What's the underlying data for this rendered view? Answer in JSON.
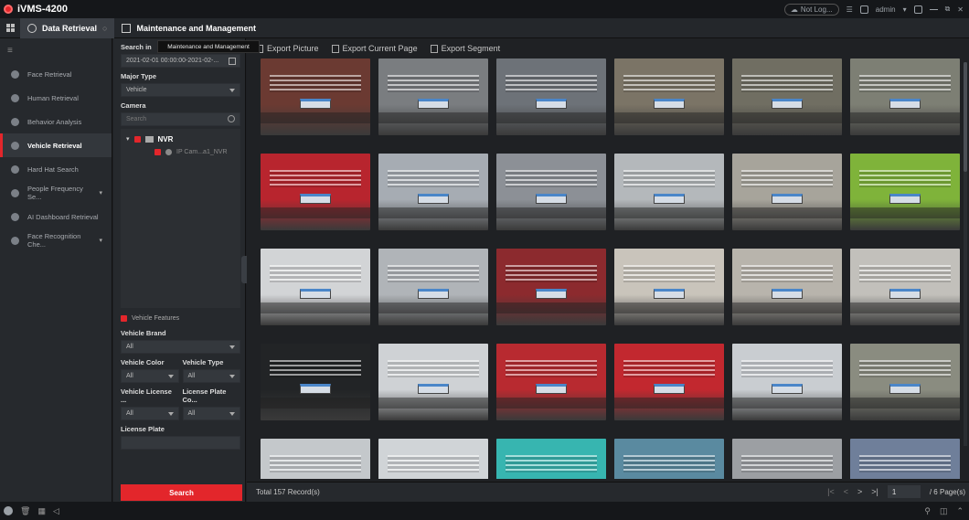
{
  "app": {
    "title": "iVMS-4200",
    "not_logged": "Not Log...",
    "user": "admin",
    "user_caret": "▾",
    "window_controls": [
      "☰",
      "▣",
      "—",
      "⧉",
      "✕"
    ]
  },
  "tabs": [
    {
      "label": "Data Retrieval",
      "close": "○"
    },
    {
      "label": "Maintenance and Management"
    }
  ],
  "tooltip": "Maintenance and Management",
  "nav": {
    "menu_icon": "≡",
    "items": [
      {
        "label": "Face Retrieval"
      },
      {
        "label": "Human Retrieval"
      },
      {
        "label": "Behavior Analysis"
      },
      {
        "label": "Vehicle Retrieval"
      },
      {
        "label": "Hard Hat Search"
      },
      {
        "label": "People Frequency Se...",
        "arrow": "▾"
      },
      {
        "label": "AI Dashboard Retrieval"
      },
      {
        "label": "Face Recognition Che...",
        "arrow": "▾"
      }
    ]
  },
  "filter": {
    "search_in_label": "Search in",
    "time_range": "2021-02-01 00:00:00-2021-02-...",
    "major_type_label": "Major Type",
    "major_type_value": "Vehicle",
    "camera_label": "Camera",
    "camera_search_placeholder": "Search",
    "tree_root": "NVR",
    "tree_child": "IP Cam...a1_NVR",
    "tree_caret": "▾",
    "vehicle_features": "Vehicle Features",
    "vehicle_brand_label": "Vehicle Brand",
    "vehicle_brand_value": "All",
    "vehicle_color_label": "Vehicle Color",
    "vehicle_color_value": "All",
    "vehicle_type_label": "Vehicle Type",
    "vehicle_type_value": "All",
    "plate_type_label": "Vehicle License ...",
    "plate_type_value": "All",
    "plate_color_label": "License Plate Co...",
    "plate_color_value": "All",
    "license_plate_label": "License Plate",
    "license_plate_value": "",
    "search_button": "Search"
  },
  "toolbar": {
    "export_picture": "Export Picture",
    "export_current_page": "Export Current Page",
    "export_segment": "Export Segment"
  },
  "results": {
    "total": "Total 157 Record(s)",
    "page_current": "1",
    "page_total": "/ 6 Page(s)",
    "pager_first": "|<",
    "pager_prev": "<",
    "pager_next": ">",
    "pager_last": ">|",
    "thumb_colors": [
      "#6b3a32",
      "#7a7d80",
      "#6d7278",
      "#7b7466",
      "#706e62",
      "#7d7f74",
      "#b8252e",
      "#a6acb3",
      "#8c9096",
      "#b4b8bb",
      "#a7a49b",
      "#7fb33a",
      "#d2d4d6",
      "#b0b4b8",
      "#8c2a2e",
      "#c9c4bb",
      "#b8b4ac",
      "#c2c0bb",
      "#222426",
      "#cfd2d5",
      "#b82a30",
      "#c2282f",
      "#c9cdd1",
      "#8a8c80",
      "#c4c8cb",
      "#d0d4d7",
      "#37b5b0",
      "#5a8aa0",
      "#9c9fa3",
      "#6f7f9a"
    ]
  },
  "statusbar": {
    "right_icons": [
      "⚲",
      "◫",
      "⌃"
    ]
  }
}
